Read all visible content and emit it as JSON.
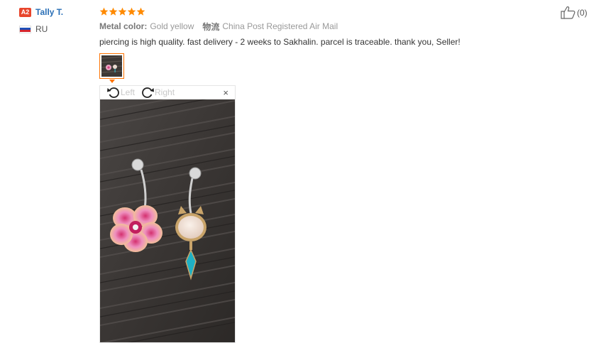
{
  "user": {
    "level_badge": "A2",
    "name": "Tally T.",
    "country": "RU",
    "flag_colors": [
      "#ffffff",
      "#1f4fb8",
      "#d5262e"
    ]
  },
  "review": {
    "rating": 5,
    "star_color": "#ff8a00",
    "metal_color_label": "Metal color:",
    "metal_color_value": "Gold yellow",
    "logistics_label": "物流",
    "logistics_value": "China Post Registered Air Mail",
    "feedback": "piercing is high quality. fast delivery - 2 weeks to Sakhalin. parcel is traceable. thank you, Seller!"
  },
  "viewer": {
    "rotate_left_label": "Left",
    "rotate_right_label": "Right",
    "close_label": "×"
  },
  "helpful": {
    "count": "(0)"
  },
  "colors": {
    "accent": "#ff7300",
    "username": "#2a6fb6",
    "badge": "#e8452c"
  }
}
